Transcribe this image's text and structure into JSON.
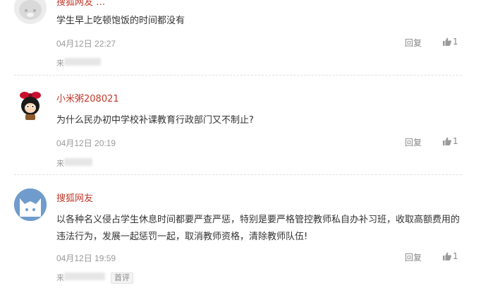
{
  "comments": [
    {
      "username": "搜狐网友 …",
      "content": "学生早上吃顿饱饭的时间都没有",
      "time": "04月12日 22:27",
      "reply_label": "回复",
      "like_count": "1",
      "source_prefix": "来"
    },
    {
      "username": "小米粥208021",
      "content": "为什么民办初中学校补课教育行政部门又不制止?",
      "time": "04月12日 20:19",
      "reply_label": "回复",
      "like_count": "1",
      "source_prefix": "来"
    },
    {
      "username": "搜狐网友",
      "content": "以各种名义侵占学生休息时间都要严查严惩，特别是要严格管控教师私自办补习班，收取高额费用的违法行为，发展一起惩罚一起，取消教师资格，清除教师队伍!",
      "time": "04月12日 19:59",
      "reply_label": "回复",
      "like_count": "1",
      "source_prefix": "来",
      "badge": "首评"
    }
  ],
  "colors": {
    "username": "#c0392b",
    "text": "#333333",
    "meta": "#999999",
    "divider": "#e1e1e1"
  },
  "icons": {
    "like": "thumbs-up-icon",
    "avatar_default": "grey-cat-avatar-icon",
    "avatar_custom": "cartoon-character-avatar-icon",
    "avatar_sohu": "blue-fox-avatar-icon"
  }
}
